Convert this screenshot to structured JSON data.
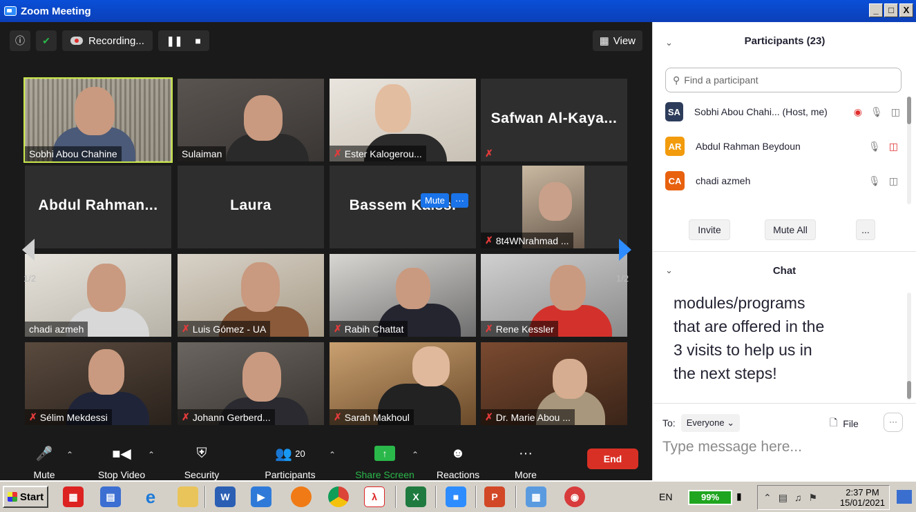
{
  "window": {
    "title": "Zoom Meeting",
    "buttons": [
      "_",
      "□",
      "X"
    ]
  },
  "meeting": {
    "recording_label": "Recording...",
    "view_label": "View",
    "mute_popup": {
      "mute_label": "Mute",
      "more_label": "···"
    },
    "page_left": "1/2",
    "page_right": "1/2",
    "tiles": [
      {
        "name": "Sobhi Abou Chahine",
        "video": true,
        "muted": false,
        "active": true
      },
      {
        "name": "Sulaiman",
        "video": true,
        "muted": false
      },
      {
        "name": "Ester Kalogerou...",
        "video": true,
        "muted": true
      },
      {
        "name": "",
        "display_name": "Safwan  Al-Kaya...",
        "video": false,
        "muted": true
      },
      {
        "name": "",
        "display_name": "Abdul  Rahman...",
        "video": false,
        "muted": false
      },
      {
        "name": "",
        "display_name": "Laura",
        "video": false,
        "muted": false
      },
      {
        "name": "",
        "display_name": "Bassem Kaissi",
        "video": false,
        "muted": false
      },
      {
        "name": "8t4WNrahmad ...",
        "video": true,
        "muted": true
      },
      {
        "name": "chadi azmeh",
        "video": true,
        "muted": false
      },
      {
        "name": "Luis Gómez - UA",
        "video": true,
        "muted": true
      },
      {
        "name": "Rabih Chattat",
        "video": true,
        "muted": true
      },
      {
        "name": "Rene Kessler",
        "video": true,
        "muted": true
      },
      {
        "name": "Sélim Mekdessi",
        "video": true,
        "muted": true
      },
      {
        "name": "Johann Gerberd...",
        "video": true,
        "muted": true
      },
      {
        "name": "Sarah Makhoul",
        "video": true,
        "muted": true
      },
      {
        "name": "Dr. Marie Abou ...",
        "video": true,
        "muted": true
      }
    ]
  },
  "toolbar": {
    "mute": "Mute",
    "stop_video": "Stop Video",
    "security": "Security",
    "participants": "Participants",
    "participants_count": "20",
    "share_screen": "Share Screen",
    "reactions": "Reactions",
    "more": "More",
    "end": "End"
  },
  "panel": {
    "participants_title": "Participants (23)",
    "search_placeholder": "Find a participant",
    "participants": [
      {
        "initials": "SA",
        "name": "Sobhi Abou Chahi... (Host, me)",
        "color": "#2d3c5a"
      },
      {
        "initials": "AR",
        "name": "Abdul Rahman Beydoun",
        "color": "#f29b0c"
      },
      {
        "initials": "CA",
        "name": "chadi azmeh",
        "color": "#e8610e"
      }
    ],
    "invite": "Invite",
    "mute_all": "Mute All",
    "more": "...",
    "chat_title": "Chat",
    "chat_lines": [
      "modules/programs",
      "that are offered in the",
      "3 visits to help us in",
      "the next steps!"
    ],
    "to_label": "To:",
    "to_value": "Everyone",
    "file_label": "File",
    "message_placeholder": "Type message here..."
  },
  "taskbar": {
    "start": "Start",
    "language": "EN",
    "battery": "99%",
    "time": "2:37 PM",
    "date": "15/01/2021"
  }
}
